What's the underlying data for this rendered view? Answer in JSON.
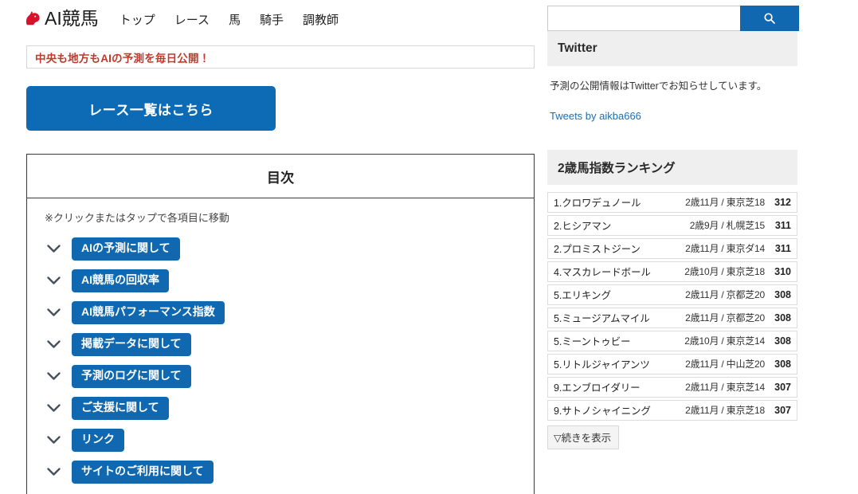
{
  "site": {
    "brand_name": "AI競馬",
    "logo_icon": "horse-head-icon",
    "accent_blue": "#0d6ab4",
    "pill_blue": "#1068b0",
    "notice_red": "#c0392b"
  },
  "nav": {
    "items": [
      {
        "label": "トップ"
      },
      {
        "label": "レース"
      },
      {
        "label": "馬"
      },
      {
        "label": "騎手"
      },
      {
        "label": "調教師"
      }
    ]
  },
  "search": {
    "value": "",
    "placeholder": "",
    "icon": "search-icon"
  },
  "notice": {
    "text": "中央も地方もAIの予測を毎日公開！"
  },
  "cta": {
    "label": "レース一覧はこちら"
  },
  "toc": {
    "title": "目次",
    "note": "※クリックまたはタップで各項目に移動",
    "chevron_icon": "chevron-down-icon",
    "items": [
      {
        "label": "AIの予測に関して"
      },
      {
        "label": "AI競馬の回収率"
      },
      {
        "label": "AI競馬パフォーマンス指数"
      },
      {
        "label": "掲載データに関して"
      },
      {
        "label": "予測のログに関して"
      },
      {
        "label": "ご支援に関して"
      },
      {
        "label": "リンク"
      },
      {
        "label": "サイトのご利用に関して"
      }
    ]
  },
  "twitter": {
    "title": "Twitter",
    "description": "予測の公開情報はTwitterでお知らせしています。",
    "link_label": "Tweets by aikba666"
  },
  "ranking": {
    "title": "2歳馬指数ランキング",
    "more_label": "▽続きを表示",
    "rows": [
      {
        "name": "1.クロワデュノール",
        "meta": "2歳11月 / 東京芝18",
        "score": "312"
      },
      {
        "name": "2.ヒシアマン",
        "meta": "2歳9月 / 札幌芝15",
        "score": "311"
      },
      {
        "name": "2.プロミストジーン",
        "meta": "2歳11月 / 東京ダ14",
        "score": "311"
      },
      {
        "name": "4.マスカレードボール",
        "meta": "2歳10月 / 東京芝18",
        "score": "310"
      },
      {
        "name": "5.エリキング",
        "meta": "2歳11月 / 京都芝20",
        "score": "308"
      },
      {
        "name": "5.ミュージアムマイル",
        "meta": "2歳11月 / 京都芝20",
        "score": "308"
      },
      {
        "name": "5.ミーントゥビー",
        "meta": "2歳10月 / 東京芝14",
        "score": "308"
      },
      {
        "name": "5.リトルジャイアンツ",
        "meta": "2歳11月 / 中山芝20",
        "score": "308"
      },
      {
        "name": "9.エンブロイダリー",
        "meta": "2歳11月 / 東京芝14",
        "score": "307"
      },
      {
        "name": "9.サトノシャイニング",
        "meta": "2歳11月 / 東京芝18",
        "score": "307"
      }
    ]
  }
}
